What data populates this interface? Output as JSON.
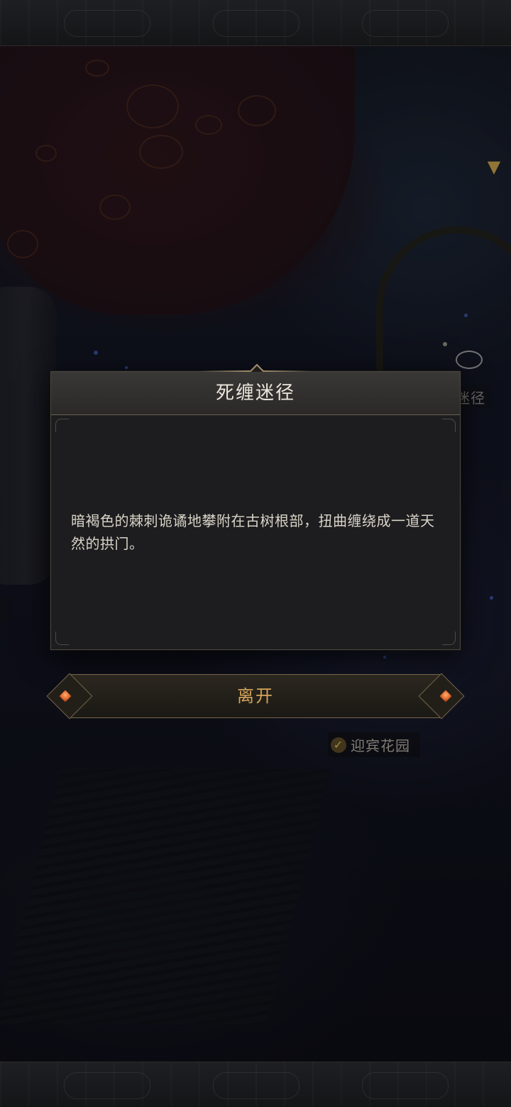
{
  "map": {
    "partial_label": "迷径",
    "garden_label": "迎宾花园",
    "location_marker_icon": "location-pin-icon",
    "ring_marker_icon": "ring-marker-icon",
    "check_icon": "check-icon"
  },
  "modal": {
    "title": "死缠迷径",
    "description": "暗褐色的棘刺诡谲地攀附在古树根部，扭曲缠绕成一道天然的拱门。"
  },
  "actions": {
    "leave_label": "离开"
  },
  "colors": {
    "modal_bg": "#1d1d1f",
    "header_bg": "#2a2928",
    "title_text": "#ece7dc",
    "body_text": "#d9d4c8",
    "button_text": "#d6a55a",
    "accent_gold": "#a28e6b",
    "gem_orange": "#e0632a"
  }
}
